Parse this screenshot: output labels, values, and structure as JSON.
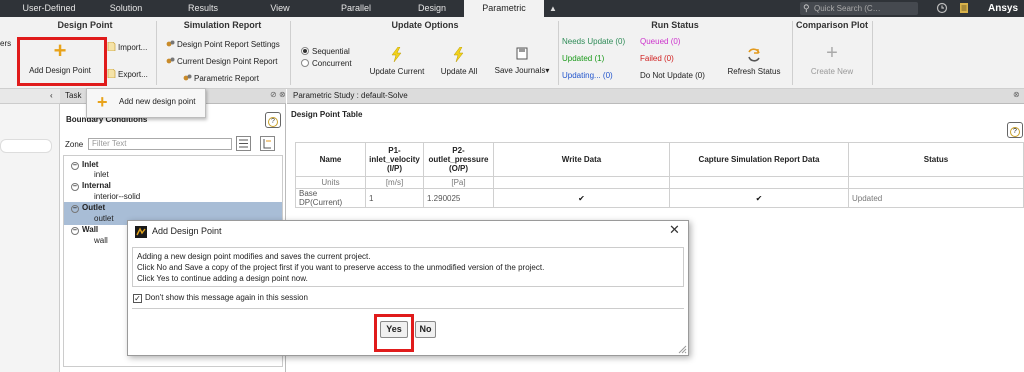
{
  "tabs": [
    {
      "label": "User-Defined"
    },
    {
      "label": "Solution"
    },
    {
      "label": "Results"
    },
    {
      "label": "View"
    },
    {
      "label": "Parallel"
    },
    {
      "label": "Design"
    },
    {
      "label": "Parametric"
    }
  ],
  "search": {
    "placeholder": "Quick Search (C…"
  },
  "brand": "Ansys",
  "ribbon": {
    "left_cut": "ers",
    "design_point": {
      "title": "Design Point",
      "add": "Add Design Point",
      "import": "Import...",
      "export": "Export..."
    },
    "simulation_report": {
      "title": "Simulation Report",
      "settings": "Design Point Report Settings",
      "current": "Current Design Point Report",
      "parametric": "Parametric Report"
    },
    "update_options": {
      "title": "Update Options",
      "sequential": "Sequential",
      "concurrent": "Concurrent",
      "update_current": "Update Current",
      "update_all": "Update All",
      "save_journals": "Save Journals"
    },
    "run_status": {
      "title": "Run Status",
      "needs_update": "Needs Update (0)",
      "queued": "Queued (0)",
      "updated": "Updated (1)",
      "failed": "Failed (0)",
      "updating": "Updating... (0)",
      "do_not_update": "Do Not Update (0)",
      "refresh": "Refresh Status",
      "colors": {
        "needs": "#2e8b57",
        "queued": "#cc33cc",
        "updated": "#1a9a1a",
        "failed": "#d12020",
        "updating": "#2255cc"
      }
    },
    "comparison_plot": {
      "title": "Comparison Plot",
      "create_new": "Create New"
    }
  },
  "context_menu": {
    "add_new": "Add new design point"
  },
  "task_panel": {
    "title": "Task",
    "boundary_conditions": "Boundary Conditions",
    "zone_label": "Zone",
    "filter_placeholder": "Filter Text",
    "tree": [
      {
        "label": "Inlet",
        "group": true
      },
      {
        "label": "inlet",
        "group": false
      },
      {
        "label": "Internal",
        "group": true
      },
      {
        "label": "interior--solid",
        "group": false
      },
      {
        "label": "Outlet",
        "group": true
      },
      {
        "label": "outlet",
        "group": false
      },
      {
        "label": "Wall",
        "group": true
      },
      {
        "label": "wall",
        "group": false
      }
    ]
  },
  "main_panel": {
    "title": "Parametric Study : default-Solve",
    "table_title": "Design Point Table",
    "columns": {
      "name": "Name",
      "p1": "P1-",
      "p1_sub": "inlet_velocity",
      "p1_io": "(I/P)",
      "p2": "P2-",
      "p2_sub": "outlet_pressure",
      "p2_io": "(O/P)",
      "write": "Write Data",
      "capture": "Capture Simulation Report Data",
      "status": "Status"
    },
    "units_row": {
      "label": "Units",
      "p1": "[m/s]",
      "p2": "[Pa]"
    },
    "rows": [
      {
        "name": "Base DP(Current)",
        "p1": "1",
        "p2": "1.290025",
        "write": "✔",
        "capture": "✔",
        "status": "Updated"
      }
    ]
  },
  "dialog": {
    "title": "Add Design Point",
    "line1": "Adding a new design point modifies and saves the current project.",
    "line2": "Click No and Save a copy of the project first if you want to preserve access to the unmodified version of the project.",
    "line3": "Click Yes to continue adding a design point now.",
    "checkbox": "Don't show this message again in this session",
    "yes": "Yes",
    "no": "No"
  }
}
